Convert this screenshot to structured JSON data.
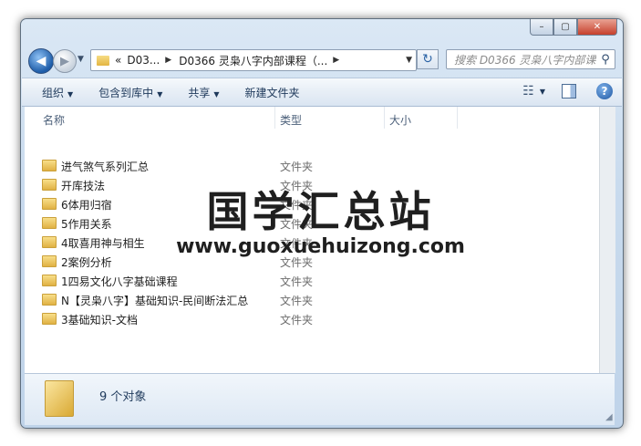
{
  "window": {
    "caption": {
      "minimize": "–",
      "maximize": "▢",
      "close": "✕"
    }
  },
  "nav": {
    "back": "◀",
    "forward": "▶",
    "recent": "▼",
    "address": {
      "overflow": "«",
      "segments": [
        "D03...",
        "D0366 灵枭八字内部课程（..."
      ],
      "separator": "▶",
      "dropdown": "▼"
    },
    "refresh": "↻",
    "search": {
      "placeholder": "搜索 D0366 灵枭八字内部课程...",
      "icon": "search-icon"
    }
  },
  "toolbar": {
    "organize": "组织",
    "include_in_library": "包含到库中",
    "share": "共享",
    "new_folder": "新建文件夹",
    "caret": "▼",
    "views_icon": "☷"
  },
  "columns": {
    "name": "名称",
    "type": "类型",
    "size": "大小"
  },
  "files": [
    {
      "name": "进气煞气系列汇总",
      "type": "文件夹"
    },
    {
      "name": "开库技法",
      "type": "文件夹"
    },
    {
      "name": "6体用归宿",
      "type": "文件夹"
    },
    {
      "name": "5作用关系",
      "type": "文件夹"
    },
    {
      "name": "4取喜用神与相生",
      "type": "文件夹"
    },
    {
      "name": "2案例分析",
      "type": "文件夹"
    },
    {
      "name": "1四易文化八字基础课程",
      "type": "文件夹"
    },
    {
      "name": "N【灵枭八字】基础知识-民间断法汇总",
      "type": "文件夹"
    },
    {
      "name": "3基础知识-文档",
      "type": "文件夹"
    }
  ],
  "status": {
    "count_text": "9 个对象"
  },
  "watermark": {
    "title": "国学汇总站",
    "url": "www.guoxuehuizong.com"
  },
  "colors": {
    "folder": "#e3b542",
    "accent": "#1f57a2"
  }
}
